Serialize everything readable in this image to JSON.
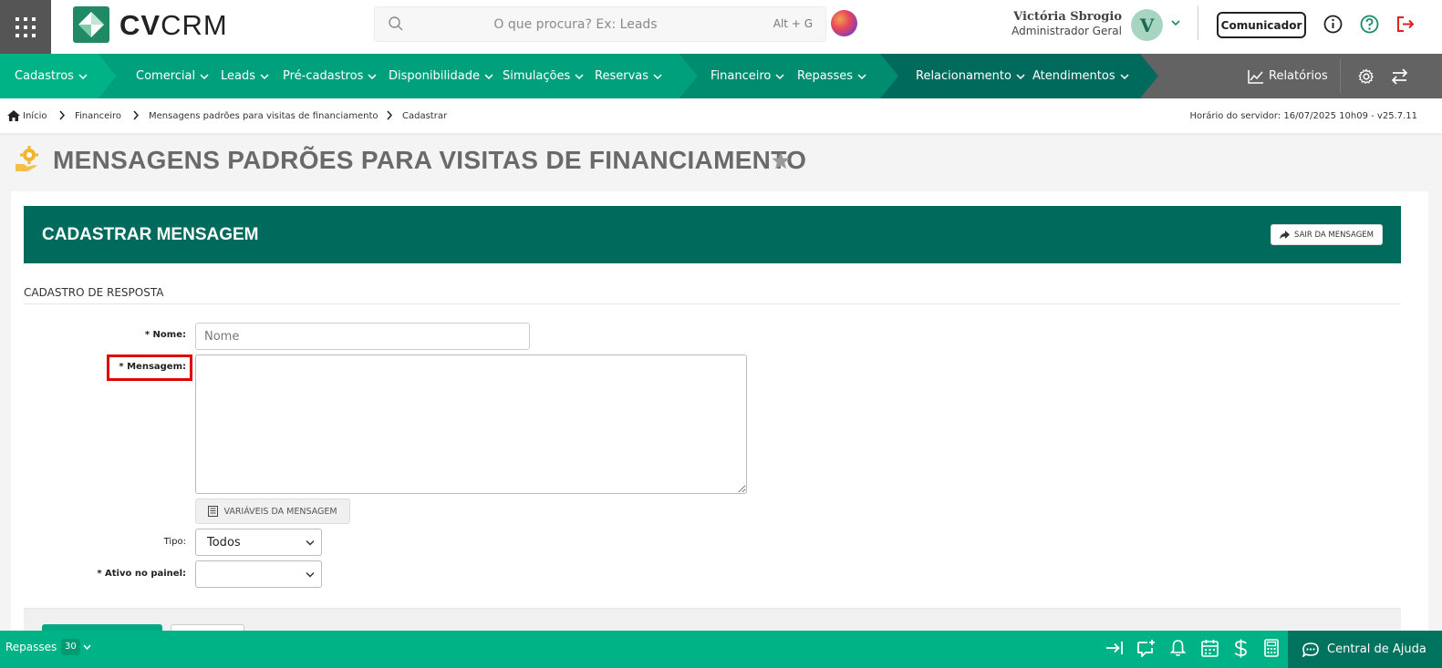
{
  "header": {
    "logo_brand_bold": "CV",
    "logo_brand_light": "CRM",
    "search_placeholder": "O que procura? Ex: Leads",
    "search_shortcut": "Alt + G",
    "user_name": "Victória Sbrogio",
    "user_role": "Administrador Geral",
    "user_initial": "V",
    "communicator_label": "Comunicador"
  },
  "nav": {
    "items": [
      {
        "label": "Cadastros"
      },
      {
        "label": "Comercial"
      },
      {
        "label": "Leads"
      },
      {
        "label": "Pré-cadastros"
      },
      {
        "label": "Disponibilidade"
      },
      {
        "label": "Simulações"
      },
      {
        "label": "Reservas"
      },
      {
        "label": "Financeiro"
      },
      {
        "label": "Repasses"
      },
      {
        "label": "Relacionamento"
      },
      {
        "label": "Atendimentos"
      }
    ],
    "reports_label": "Relatórios",
    "colors": {
      "seg1": "#00b386",
      "seg2": "#00a07c",
      "seg3": "#008c6e",
      "seg4": "#006b5d",
      "rest": "#636363"
    }
  },
  "breadcrumb": {
    "items": [
      "Início",
      "Financeiro",
      "Mensagens padrões para visitas de financiamento",
      "Cadastrar"
    ],
    "server_time": "Horário do servidor: 16/07/2025 10h09 - v25.7.11"
  },
  "page": {
    "title": "MENSAGENS PADRÕES PARA VISITAS DE FINANCIAMENTO"
  },
  "card": {
    "title": "CADASTRAR MENSAGEM",
    "exit_label": "SAIR DA MENSAGEM",
    "section_title": "CADASTRO DE RESPOSTA"
  },
  "form": {
    "name_label": "* Nome:",
    "name_placeholder": "Nome",
    "message_label": "* Mensagem:",
    "variables_label": "VARIÁVEIS DA MENSAGEM",
    "type_label": "Tipo:",
    "type_value": "Todos",
    "active_label": "* Ativo no painel:",
    "active_value": ""
  },
  "bottom": {
    "repasses_label": "Repasses",
    "repasses_count": "30",
    "help_label": "Central de Ajuda"
  },
  "colors": {
    "primary": "#00b386",
    "dark": "#006b5d",
    "highlight": "#e00000",
    "logout": "#e02020"
  }
}
